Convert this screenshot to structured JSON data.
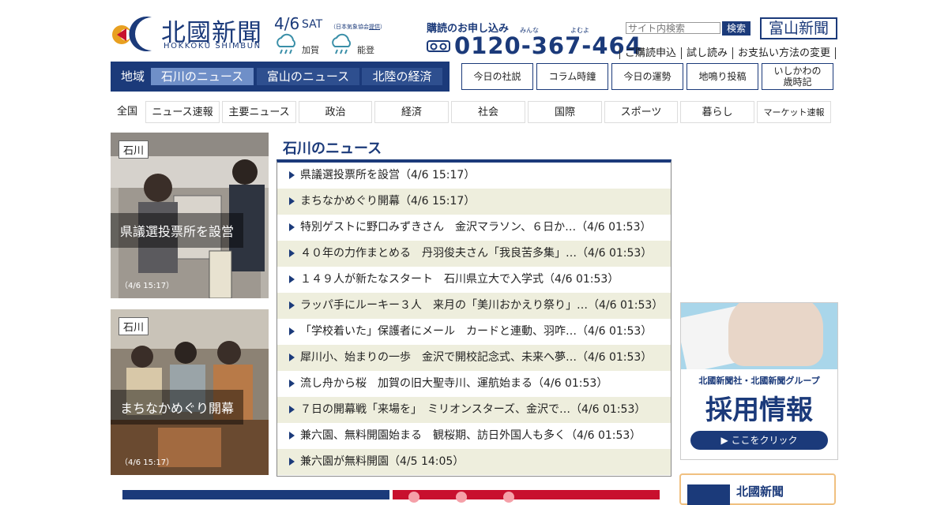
{
  "header": {
    "logo_jp": "北國新聞",
    "logo_en": "HOKKOKU SHIMBUN",
    "weather": {
      "date": "4/6",
      "dow": "SAT",
      "note_prefix": "（日本気象協会",
      "note_link": "提供",
      "note_suffix": "）",
      "areas": [
        {
          "label": "加賀",
          "icon": "rain-cloud-icon"
        },
        {
          "label": "能登",
          "icon": "rain-cloud-icon"
        }
      ]
    },
    "subscribe": {
      "title": "購読のお申し込み",
      "ruby_left": "みんな",
      "ruby_right": "よむよ",
      "phone": "0120-367-464"
    },
    "search": {
      "placeholder": "サイト内検索",
      "button": "検索"
    },
    "toyama_link": "富山新聞",
    "links": [
      "ご購読申込",
      "試し読み",
      "お支払い方法の変更"
    ]
  },
  "region_nav": {
    "label": "地域",
    "items": [
      "石川のニュース",
      "富山のニュース",
      "北陸の経済"
    ],
    "active": "石川のニュース"
  },
  "feature_buttons": [
    "今日の社説",
    "コラム時鐘",
    "今日の運勢",
    "地鳴り投稿",
    "いしかわの|歳時記"
  ],
  "category_nav": [
    "全国",
    "ニュース速報",
    "主要ニュース",
    "政治",
    "経済",
    "社会",
    "国際",
    "スポーツ",
    "暮らし",
    "マーケット速報"
  ],
  "photos": [
    {
      "tag": "石川",
      "caption": "県議選投票所を設営",
      "time": "（4/6 15:17）"
    },
    {
      "tag": "石川",
      "caption": "まちなかめぐり開幕",
      "time": "（4/6 15:17）"
    }
  ],
  "news": {
    "section_title": "石川のニュース",
    "items": [
      "県議選投票所を設営（4/6 15:17）",
      "まちなかめぐり開幕（4/6 15:17）",
      "特別ゲストに野口みずきさん　金沢マラソン、６日か…（4/6 01:53）",
      "４０年の力作まとめる　丹羽俊夫さん「我良苦多集」…（4/6 01:53）",
      "１４９人が新たなスタート　石川県立大で入学式（4/6 01:53）",
      "ラッパ手にルーキー３人　来月の「美川おかえり祭り」…（4/6 01:53）",
      "「学校着いた」保護者にメール　カードと連動、羽咋…（4/6 01:53）",
      "犀川小、始まりの一歩　金沢で開校記念式、未来へ夢…（4/6 01:53）",
      "流し舟から桜　加賀の旧大聖寺川、運航始まる（4/6 01:53）",
      "７日の開幕戦「来場を」　ミリオンスターズ、金沢で…（4/6 01:53）",
      "兼六園、無料開園始まる　観桜期、訪日外国人も多く（4/6 01:53）",
      "兼六園が無料開園（4/5 14:05）"
    ]
  },
  "ad": {
    "line1": "北國新聞社・北國新聞グループ",
    "line2": "採用情報",
    "button": "▶ ここをクリック"
  },
  "bottom_box": {
    "title": "北國新聞",
    "badge": "北國新聞"
  },
  "colors": {
    "brand": "#1b3a7a",
    "active_tab": "#6f8fc8",
    "alt_row": "#eeeedd"
  }
}
